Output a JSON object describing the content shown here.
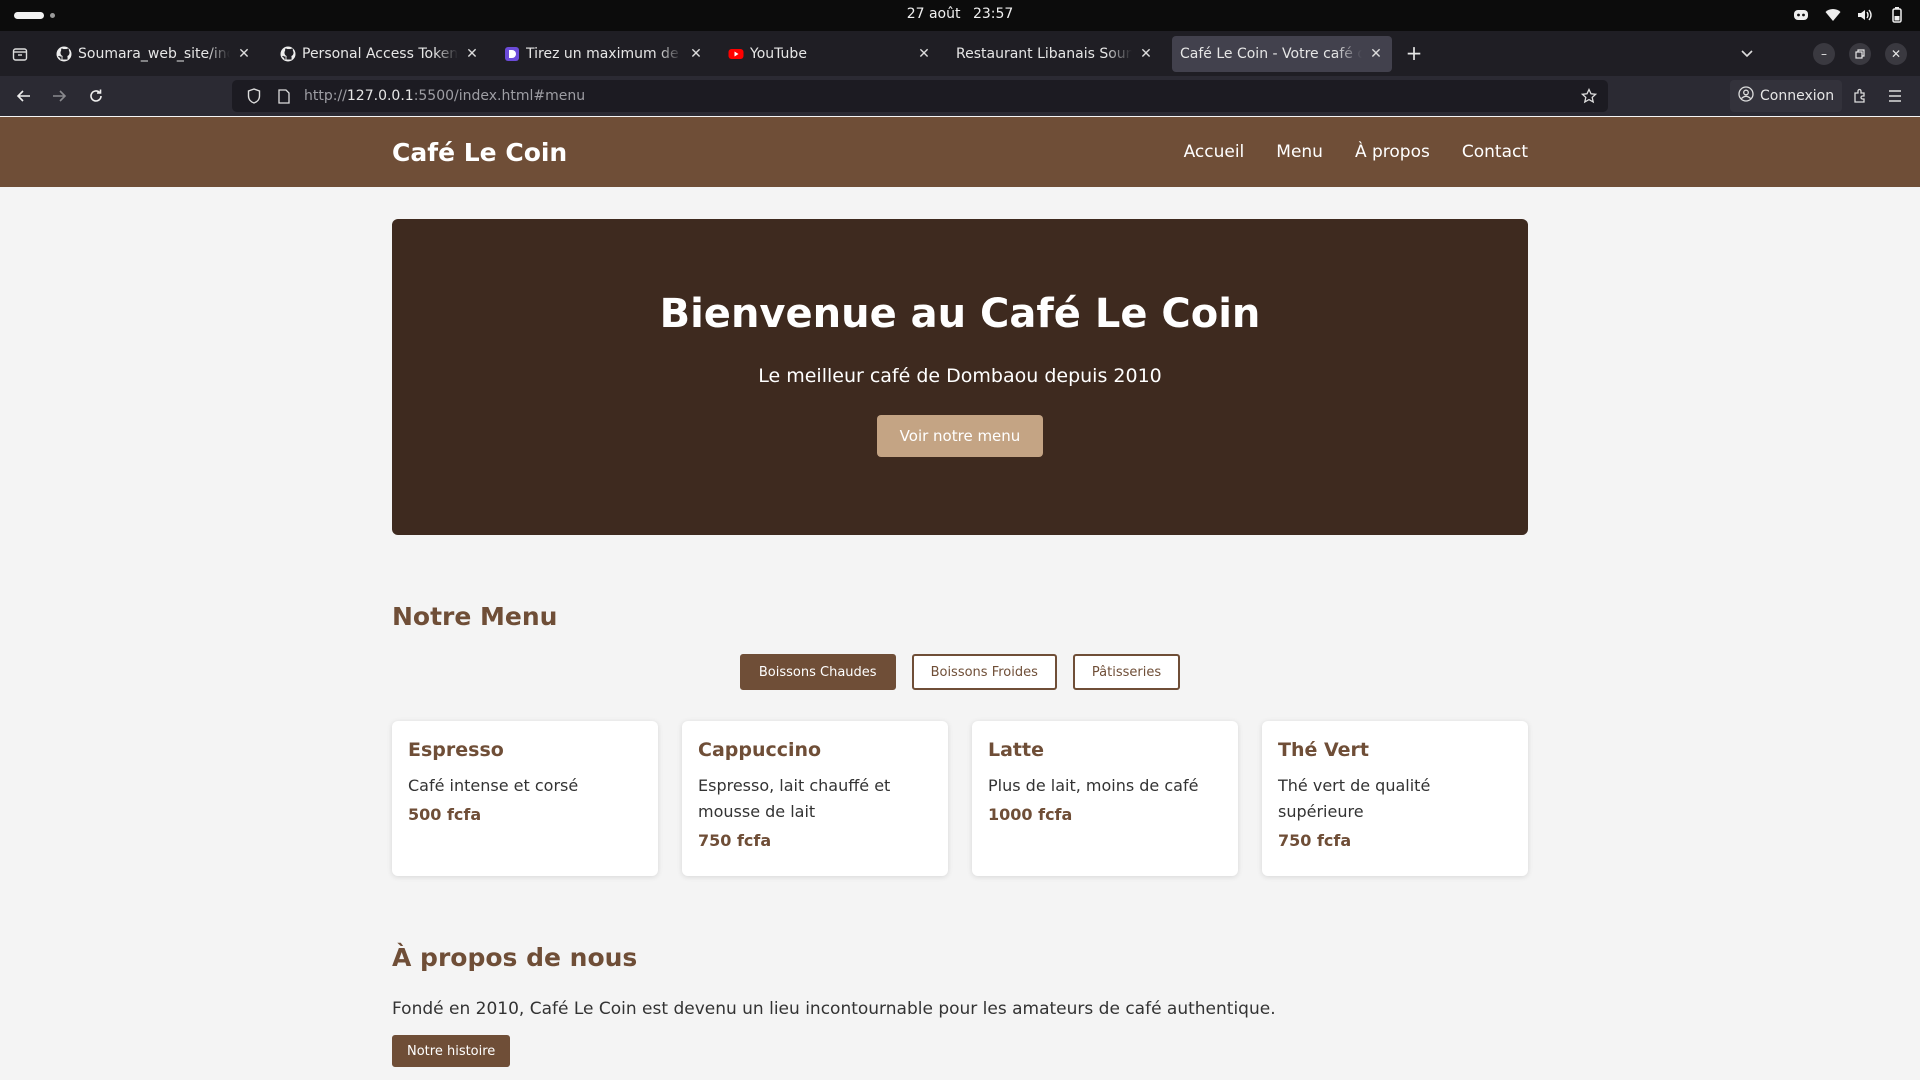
{
  "os": {
    "date": "27 août",
    "time": "23:57",
    "tray_icons": [
      "discord-icon",
      "wifi-icon",
      "volume-icon",
      "battery-icon"
    ]
  },
  "browser": {
    "tabs": [
      {
        "title": "Soumara_web_site/index",
        "icon": "github-icon"
      },
      {
        "title": "Personal Access Tokens (C",
        "icon": "github-icon"
      },
      {
        "title": "Tirez un maximum de ce c",
        "icon": "page-icon"
      },
      {
        "title": "YouTube",
        "icon": "youtube-icon"
      },
      {
        "title": "Restaurant Libanais Soumara",
        "icon": "none"
      },
      {
        "title": "Café Le Coin - Votre café de c",
        "icon": "none",
        "active": true
      }
    ],
    "new_tab_label": "+",
    "url_prefix": "http://",
    "url_host": "127.0.0.1",
    "url_rest": ":5500/index.html#menu",
    "signin_label": "Connexion"
  },
  "site": {
    "logo": "Café Le Coin",
    "nav": [
      "Accueil",
      "Menu",
      "À propos",
      "Contact"
    ],
    "hero": {
      "title": "Bienvenue au Café Le Coin",
      "subtitle": "Le meilleur café de Dombaou depuis 2010",
      "cta": "Voir notre menu"
    },
    "menu": {
      "title": "Notre Menu",
      "filters": [
        "Boissons Chaudes",
        "Boissons Froides",
        "Pâtisseries"
      ],
      "active_filter": "Boissons Chaudes",
      "items": [
        {
          "name": "Espresso",
          "desc": "Café intense et corsé",
          "price": "500 fcfa"
        },
        {
          "name": "Cappuccino",
          "desc": "Espresso, lait chauffé et mousse de lait",
          "price": "750 fcfa"
        },
        {
          "name": "Latte",
          "desc": "Plus de lait, moins de café",
          "price": "1000 fcfa"
        },
        {
          "name": "Thé Vert",
          "desc": "Thé vert de qualité supérieure",
          "price": "750 fcfa"
        }
      ]
    },
    "about": {
      "title": "À propos de nous",
      "text": "Fondé en 2010, Café Le Coin est devenu un lieu incontournable pour les amateurs de café authentique.",
      "button": "Notre histoire"
    }
  },
  "colors": {
    "brand": "#6f4e37",
    "hero_bg": "#3e2a1f",
    "cta": "#c4a484"
  }
}
